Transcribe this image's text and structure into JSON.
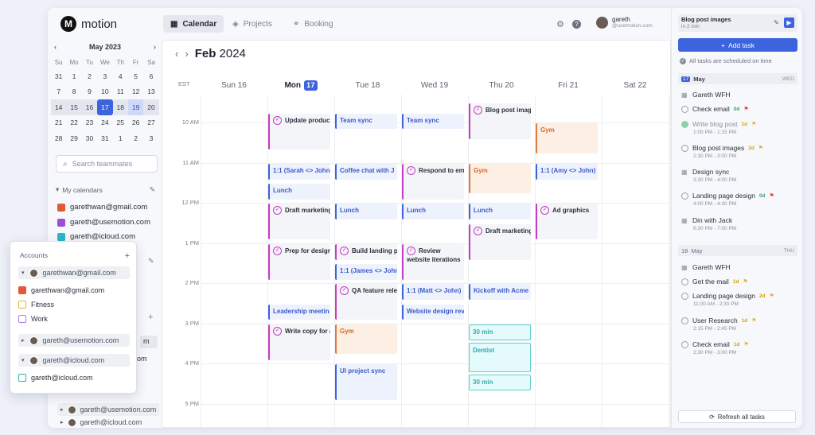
{
  "app": {
    "name": "motion",
    "logo_glyph": "M"
  },
  "tabs": [
    {
      "label": "Calendar",
      "icon": "calendar-icon"
    },
    {
      "label": "Projects",
      "icon": "projects-icon"
    },
    {
      "label": "Booking",
      "icon": "link-icon"
    }
  ],
  "user": {
    "name": "gareth",
    "email": "@usemotion.com"
  },
  "mini_calendar": {
    "month": "May 2023",
    "dow": [
      "Su",
      "Mo",
      "Tu",
      "We",
      "Th",
      "Fr",
      "Sa"
    ],
    "weeks": [
      [
        "31",
        "1",
        "2",
        "3",
        "4",
        "5",
        "6"
      ],
      [
        "7",
        "8",
        "9",
        "10",
        "11",
        "12",
        "13"
      ],
      [
        "14",
        "15",
        "16",
        "17",
        "18",
        "19",
        "20"
      ],
      [
        "21",
        "22",
        "23",
        "24",
        "25",
        "26",
        "27"
      ],
      [
        "28",
        "29",
        "30",
        "31",
        "1",
        "2",
        "3"
      ]
    ]
  },
  "search": {
    "placeholder": "Search teammates"
  },
  "my_calendars": {
    "title": "My calendars",
    "items": [
      "garethwan@gmail.com",
      "gareth@usemotion.com",
      "gareth@icloud.com"
    ]
  },
  "accounts_popup": {
    "title": "Accounts",
    "add": "+",
    "groups": [
      {
        "account": "garethwan@gmail.com",
        "items": [
          "garethwan@gmail.com",
          "Fitness",
          "Work"
        ]
      },
      {
        "account": "gareth@usemotion.com",
        "items": []
      },
      {
        "account": "gareth@icloud.com",
        "items": [
          "gareth@icloud.com"
        ]
      }
    ]
  },
  "behind_popup": {
    "frag1": "m",
    "frag2": "om"
  },
  "bottom_accounts": [
    "gareth@usemotion.com",
    "gareth@icloud.com"
  ],
  "calendar": {
    "title_month": "Feb",
    "title_year": "2024",
    "tz": "EST",
    "days": [
      {
        "label": "Sun 16"
      },
      {
        "label": "Mon",
        "num": "17"
      },
      {
        "label": "Tue 18"
      },
      {
        "label": "Wed 19"
      },
      {
        "label": "Thu 20"
      },
      {
        "label": "Fri 21"
      },
      {
        "label": "Sat 22"
      }
    ],
    "times": [
      "10 AM",
      "11 AM",
      "12 PM",
      "1 PM",
      "2 PM",
      "3 PM",
      "4 PM",
      "5 PM"
    ]
  },
  "events": [
    {
      "title": "Update produc",
      "day": 1,
      "start": 9.75,
      "end": 10.7,
      "kind": "task"
    },
    {
      "title": "1:1 (Sarah <> John",
      "day": 1,
      "start": 11.0,
      "end": 11.45,
      "kind": "meet"
    },
    {
      "title": "Lunch",
      "day": 1,
      "start": 11.5,
      "end": 11.95,
      "kind": "meet"
    },
    {
      "title": "Draft marketing",
      "day": 1,
      "start": 12.0,
      "end": 12.95,
      "kind": "task"
    },
    {
      "title": "Prep for design",
      "day": 1,
      "start": 13.0,
      "end": 13.95,
      "kind": "task"
    },
    {
      "title": "Leadership meetin",
      "day": 1,
      "start": 14.5,
      "end": 14.95,
      "kind": "meet"
    },
    {
      "title": "Write copy for a",
      "day": 1,
      "start": 15.0,
      "end": 15.95,
      "kind": "task"
    },
    {
      "title": "Team sync",
      "day": 2,
      "start": 9.75,
      "end": 10.2,
      "kind": "meet"
    },
    {
      "title": "Coffee chat with J",
      "day": 2,
      "start": 11.0,
      "end": 11.45,
      "kind": "meet"
    },
    {
      "title": "Lunch",
      "day": 2,
      "start": 12.0,
      "end": 12.45,
      "kind": "meet"
    },
    {
      "title": "Build landing p",
      "day": 2,
      "start": 13.0,
      "end": 13.45,
      "kind": "task"
    },
    {
      "title": "1:1 (James <> John",
      "day": 2,
      "start": 13.5,
      "end": 13.95,
      "kind": "meet"
    },
    {
      "title": "QA feature rele",
      "day": 2,
      "start": 14.0,
      "end": 14.95,
      "kind": "task"
    },
    {
      "title": "Gym",
      "day": 2,
      "start": 15.0,
      "end": 15.8,
      "kind": "gym"
    },
    {
      "title": "UI project sync",
      "day": 2,
      "start": 16.0,
      "end": 16.95,
      "kind": "meet"
    },
    {
      "title": "Team sync",
      "day": 3,
      "start": 9.75,
      "end": 10.2,
      "kind": "meet"
    },
    {
      "title": "Respond to em",
      "day": 3,
      "start": 11.0,
      "end": 11.95,
      "kind": "task"
    },
    {
      "title": "Lunch",
      "day": 3,
      "start": 12.0,
      "end": 12.45,
      "kind": "meet"
    },
    {
      "title": "Review website iterations",
      "day": 3,
      "start": 13.0,
      "end": 13.95,
      "kind": "task",
      "wrap": true
    },
    {
      "title": "1:1 (Matt <> John)",
      "day": 3,
      "start": 14.0,
      "end": 14.45,
      "kind": "meet"
    },
    {
      "title": "Website design rev",
      "day": 3,
      "start": 14.5,
      "end": 14.95,
      "kind": "meet"
    },
    {
      "title": "Blog post imag",
      "day": 4,
      "start": 9.5,
      "end": 10.45,
      "kind": "task"
    },
    {
      "title": "Gym",
      "day": 4,
      "start": 11.0,
      "end": 11.8,
      "kind": "gym"
    },
    {
      "title": "Lunch",
      "day": 4,
      "start": 12.0,
      "end": 12.45,
      "kind": "meet"
    },
    {
      "title": "Draft marketing",
      "day": 4,
      "start": 12.5,
      "end": 13.45,
      "kind": "task"
    },
    {
      "title": "Kickoff with Acme",
      "day": 4,
      "start": 14.0,
      "end": 14.45,
      "kind": "meet"
    },
    {
      "title": "30 min",
      "day": 4,
      "start": 15.0,
      "end": 15.45,
      "kind": "teal"
    },
    {
      "title": "Dentist",
      "day": 4,
      "start": 15.45,
      "end": 16.25,
      "kind": "teal"
    },
    {
      "title": "30 min",
      "day": 4,
      "start": 16.25,
      "end": 16.7,
      "kind": "teal"
    },
    {
      "title": "Gym",
      "day": 5,
      "start": 10.0,
      "end": 10.8,
      "kind": "gym"
    },
    {
      "title": "1:1 (Amy <> John)",
      "day": 5,
      "start": 11.0,
      "end": 11.45,
      "kind": "meet"
    },
    {
      "title": "Ad graphics",
      "day": 5,
      "start": 12.0,
      "end": 12.95,
      "kind": "task"
    }
  ],
  "right": {
    "top_card": {
      "title": "Blog post images",
      "sub": "in 2 min"
    },
    "add_task": "Add task",
    "scheduled_note": "All tasks are scheduled on time",
    "day1": {
      "badge": "17",
      "label": "May",
      "dow": "WED"
    },
    "day1_tasks": [
      {
        "title": "Gareth WFH",
        "meta": "",
        "type": "cal"
      },
      {
        "title": "Check email",
        "tag": "0d",
        "meta": "",
        "type": "task"
      },
      {
        "title": "Write blog post",
        "tag": "1d",
        "meta": "1:00 PM - 1:15 PM",
        "type": "done"
      },
      {
        "title": "Blog post images",
        "tag": "2d",
        "meta": "2:30 PM - 3:00 PM",
        "type": "task"
      },
      {
        "title": "Design sync",
        "meta": "3:30 PM - 4:00 PM",
        "type": "cal"
      },
      {
        "title": "Landing page design",
        "tag": "0d",
        "meta": "4:00 PM - 4:30 PM",
        "type": "task"
      },
      {
        "title": "Din with Jack",
        "meta": "6:30 PM - 7:00 PM",
        "type": "cal"
      }
    ],
    "day2": {
      "badge": "18",
      "label": "May",
      "dow": "THU"
    },
    "day2_tasks": [
      {
        "title": "Gareth WFH",
        "meta": "",
        "type": "cal"
      },
      {
        "title": "Get the mail",
        "tag": "1d",
        "meta": "",
        "type": "task"
      },
      {
        "title": "Landing page design",
        "tag": "2d",
        "meta": "11:00 AM - 2:30 PM",
        "type": "task"
      },
      {
        "title": "User Research",
        "tag": "1d",
        "meta": "2:15 PM - 2:45 PM",
        "type": "task"
      },
      {
        "title": "Check email",
        "tag": "1d",
        "meta": "2:30 PM - 3:00 PM",
        "type": "task"
      }
    ],
    "refresh": "Refresh all tasks"
  }
}
